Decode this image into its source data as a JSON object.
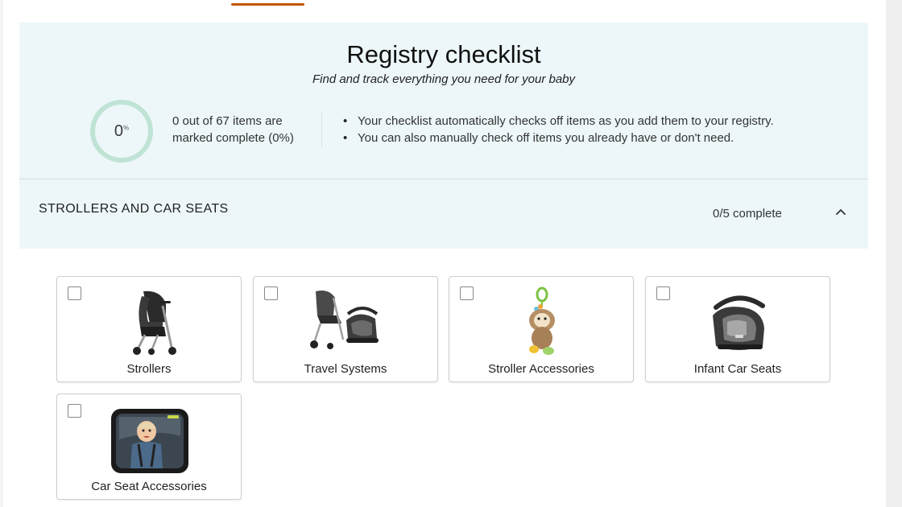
{
  "checklist": {
    "title": "Registry checklist",
    "subtitle": "Find and track everything you need for your baby",
    "progress": {
      "percent_value": "0",
      "percent_sign": "%",
      "percent_fraction": 0,
      "line1": "0 out of 67 items are",
      "line2": "marked complete (0%)"
    },
    "info_bullets": [
      "Your checklist automatically checks off items as you add them to your registry.",
      "You can also manually check off items you already have or don't need."
    ]
  },
  "section": {
    "title": "STROLLERS AND CAR SEATS",
    "count": "0/5 complete",
    "expanded": true
  },
  "categories": [
    {
      "label": "Strollers",
      "checked": false,
      "icon": "stroller-icon"
    },
    {
      "label": "Travel Systems",
      "checked": false,
      "icon": "travel-system-icon"
    },
    {
      "label": "Stroller Accessories",
      "checked": false,
      "icon": "stroller-toy-icon"
    },
    {
      "label": "Infant Car Seats",
      "checked": false,
      "icon": "infant-car-seat-icon"
    },
    {
      "label": "Car Seat Accessories",
      "checked": false,
      "icon": "car-seat-mirror-icon"
    }
  ],
  "colors": {
    "banner_bg": "#edf7fa",
    "progress_ring": "#bfe3d4",
    "tab_accent": "#c45500"
  }
}
